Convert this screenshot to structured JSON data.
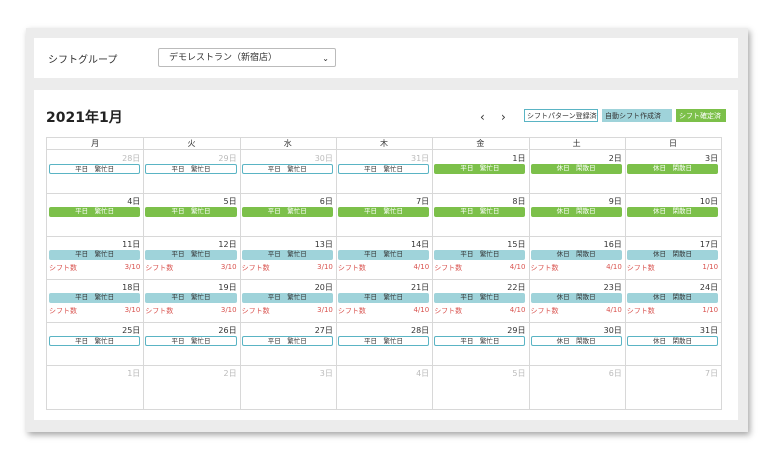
{
  "filter": {
    "label": "シフトグループ",
    "selected": "デモレストラン（新宿店）"
  },
  "calendar": {
    "month_title": "2021年1月",
    "prev": "‹",
    "next": "›",
    "legend": [
      {
        "label": "シフトパターン登録済",
        "bg": "#ffffff",
        "border": "#5ab4c4",
        "color": "#333333"
      },
      {
        "label": "自動シフト作成済",
        "bg": "#9fd3da",
        "border": "#9fd3da",
        "color": "#333333"
      },
      {
        "label": "シフト確定済",
        "bg": "#7cc04a",
        "border": "#7cc04a",
        "color": "#ffffff"
      }
    ],
    "weekdays": [
      "月",
      "火",
      "水",
      "木",
      "金",
      "土",
      "日"
    ],
    "shift_label": "シフト数",
    "weeks": [
      {
        "days": [
          {
            "date": "28日",
            "dim": true,
            "tag": "平日　繁忙日",
            "style": "outline"
          },
          {
            "date": "29日",
            "dim": true,
            "tag": "平日　繁忙日",
            "style": "outline"
          },
          {
            "date": "30日",
            "dim": true,
            "tag": "平日　繁忙日",
            "style": "outline"
          },
          {
            "date": "31日",
            "dim": true,
            "tag": "平日　繁忙日",
            "style": "outline"
          },
          {
            "date": "1日",
            "dim": false,
            "tag": "平日　繁忙日",
            "style": "green"
          },
          {
            "date": "2日",
            "dim": false,
            "tag": "休日　閑散日",
            "style": "green"
          },
          {
            "date": "3日",
            "dim": false,
            "tag": "休日　閑散日",
            "style": "green"
          }
        ]
      },
      {
        "days": [
          {
            "date": "4日",
            "dim": false,
            "tag": "平日　繁忙日",
            "style": "green"
          },
          {
            "date": "5日",
            "dim": false,
            "tag": "平日　繁忙日",
            "style": "green"
          },
          {
            "date": "6日",
            "dim": false,
            "tag": "平日　繁忙日",
            "style": "green"
          },
          {
            "date": "7日",
            "dim": false,
            "tag": "平日　繁忙日",
            "style": "green"
          },
          {
            "date": "8日",
            "dim": false,
            "tag": "平日　繁忙日",
            "style": "green"
          },
          {
            "date": "9日",
            "dim": false,
            "tag": "休日　閑散日",
            "style": "green"
          },
          {
            "date": "10日",
            "dim": false,
            "tag": "休日　閑散日",
            "style": "green"
          }
        ]
      },
      {
        "days": [
          {
            "date": "11日",
            "dim": false,
            "tag": "平日　繁忙日",
            "style": "teal",
            "shift": "3/10"
          },
          {
            "date": "12日",
            "dim": false,
            "tag": "平日　繁忙日",
            "style": "teal",
            "shift": "3/10"
          },
          {
            "date": "13日",
            "dim": false,
            "tag": "平日　繁忙日",
            "style": "teal",
            "shift": "3/10"
          },
          {
            "date": "14日",
            "dim": false,
            "tag": "平日　繁忙日",
            "style": "teal",
            "shift": "4/10"
          },
          {
            "date": "15日",
            "dim": false,
            "tag": "平日　繁忙日",
            "style": "teal",
            "shift": "4/10"
          },
          {
            "date": "16日",
            "dim": false,
            "tag": "休日　閑散日",
            "style": "teal",
            "shift": "4/10"
          },
          {
            "date": "17日",
            "dim": false,
            "tag": "休日　閑散日",
            "style": "teal",
            "shift": "1/10"
          }
        ]
      },
      {
        "days": [
          {
            "date": "18日",
            "dim": false,
            "tag": "平日　繁忙日",
            "style": "teal",
            "shift": "3/10"
          },
          {
            "date": "19日",
            "dim": false,
            "tag": "平日　繁忙日",
            "style": "teal",
            "shift": "3/10"
          },
          {
            "date": "20日",
            "dim": false,
            "tag": "平日　繁忙日",
            "style": "teal",
            "shift": "3/10"
          },
          {
            "date": "21日",
            "dim": false,
            "tag": "平日　繁忙日",
            "style": "teal",
            "shift": "4/10"
          },
          {
            "date": "22日",
            "dim": false,
            "tag": "平日　繁忙日",
            "style": "teal",
            "shift": "4/10"
          },
          {
            "date": "23日",
            "dim": false,
            "tag": "休日　閑散日",
            "style": "teal",
            "shift": "4/10"
          },
          {
            "date": "24日",
            "dim": false,
            "tag": "休日　閑散日",
            "style": "teal",
            "shift": "1/10"
          }
        ]
      },
      {
        "days": [
          {
            "date": "25日",
            "dim": false,
            "tag": "平日　繁忙日",
            "style": "outline"
          },
          {
            "date": "26日",
            "dim": false,
            "tag": "平日　繁忙日",
            "style": "outline"
          },
          {
            "date": "27日",
            "dim": false,
            "tag": "平日　繁忙日",
            "style": "outline"
          },
          {
            "date": "28日",
            "dim": false,
            "tag": "平日　繁忙日",
            "style": "outline"
          },
          {
            "date": "29日",
            "dim": false,
            "tag": "平日　繁忙日",
            "style": "outline"
          },
          {
            "date": "30日",
            "dim": false,
            "tag": "休日　閑散日",
            "style": "outline"
          },
          {
            "date": "31日",
            "dim": false,
            "tag": "休日　閑散日",
            "style": "outline"
          }
        ]
      },
      {
        "days": [
          {
            "date": "1日",
            "dim": true
          },
          {
            "date": "2日",
            "dim": true
          },
          {
            "date": "3日",
            "dim": true
          },
          {
            "date": "4日",
            "dim": true
          },
          {
            "date": "5日",
            "dim": true
          },
          {
            "date": "6日",
            "dim": true
          },
          {
            "date": "7日",
            "dim": true
          }
        ]
      }
    ]
  }
}
